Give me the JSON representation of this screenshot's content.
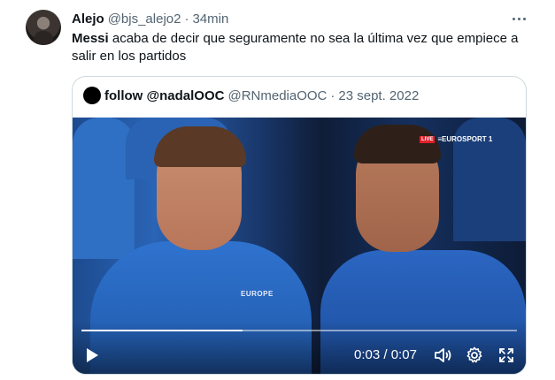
{
  "tweet": {
    "author_name": "Alejo",
    "handle": "@bjs_alejo2",
    "separator": "·",
    "time": "34min",
    "text_bold": "Messi",
    "text_rest": " acaba de decir que seguramente no sea la última vez que empiece a salir en los partidos",
    "more_icon": "more-dots-icon"
  },
  "quote": {
    "author_name": "follow @nadalOOC",
    "handle": "@RNmediaOOC",
    "separator": "·",
    "date": "23 sept. 2022",
    "video": {
      "overlay_live": "LIVE",
      "overlay_channel": "≡EUROSPORT 1",
      "jacket_logo": "EUROPE",
      "current_time": "0:03",
      "time_separator": "/",
      "duration": "0:07",
      "progress": 0.37,
      "icons": [
        "play-icon",
        "volume-icon",
        "settings-gear-icon",
        "fullscreen-icon"
      ]
    }
  },
  "colors": {
    "text_primary": "#0f1419",
    "text_secondary": "#536471",
    "border": "#cfd9de"
  }
}
